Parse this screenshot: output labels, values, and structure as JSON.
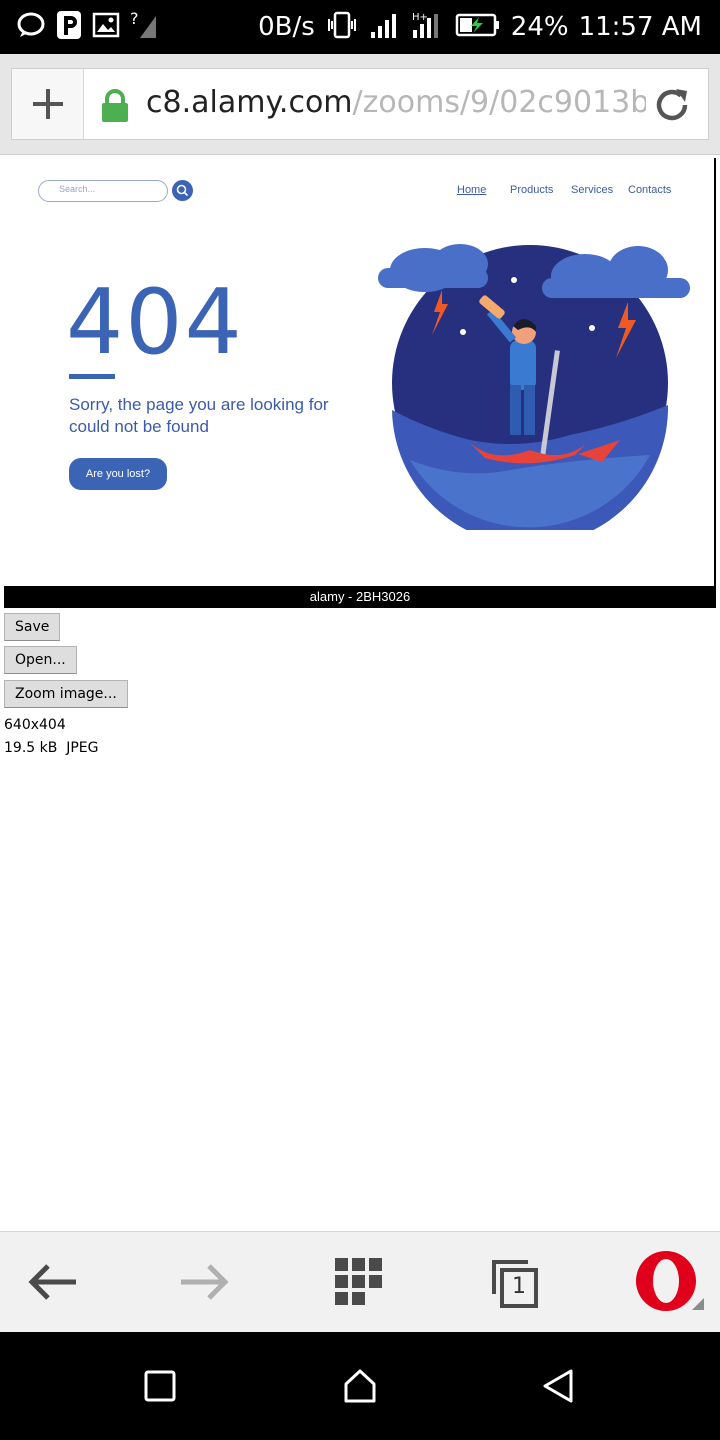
{
  "status_bar": {
    "net_speed": "0B/s",
    "battery_percent": "24%",
    "time": "11:57 AM",
    "left_icons": [
      "chat-bubble-icon",
      "p-app-icon",
      "image-icon",
      "no-signal-icon"
    ],
    "right_icons": [
      "vibrate-icon",
      "signal-icon",
      "signal-ht-icon",
      "battery-charging-icon"
    ]
  },
  "address_bar": {
    "url_domain": "c8.alamy.com",
    "url_path": "/zooms/9/02c9013b",
    "lock_color": "#4caf50"
  },
  "image": {
    "search_placeholder": "Search...",
    "nav": [
      "Home",
      "Products",
      "Services",
      "Contacts"
    ],
    "headline": "404",
    "message": "Sorry, the page you are looking for could not be found",
    "cta": "Are you lost?",
    "caption": "alamy - 2BH3026",
    "accent": "#3b64b5"
  },
  "actions": {
    "save": "Save",
    "open": "Open...",
    "zoom": "Zoom image..."
  },
  "file_info": {
    "dimensions": "640x404",
    "size_type": "19.5 kB  JPEG"
  },
  "toolbar": {
    "tab_count": "1",
    "icons": [
      "back-arrow-icon",
      "forward-arrow-icon",
      "speed-dial-grid-icon",
      "tabs-icon",
      "opera-menu-icon"
    ]
  },
  "android_nav": [
    "recents-square-icon",
    "home-icon",
    "back-triangle-icon"
  ]
}
